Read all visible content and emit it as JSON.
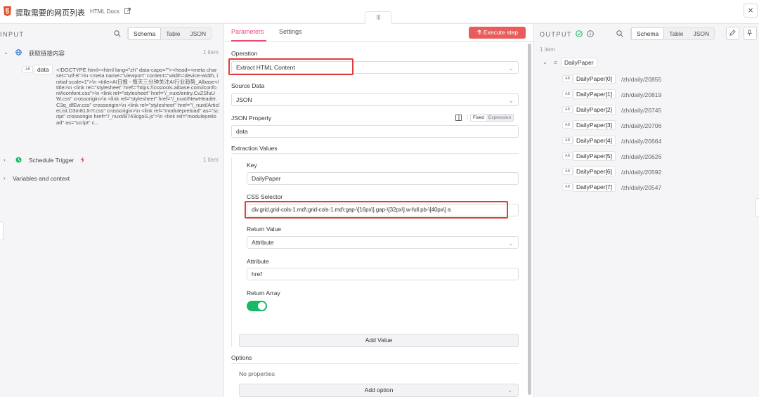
{
  "header": {
    "title": "提取需要的网页列表",
    "subtitle": "HTML Docs",
    "close": "×"
  },
  "input_panel": {
    "label": "INPUT",
    "tabs": [
      "Schema",
      "Table",
      "JSON"
    ],
    "node1": {
      "name": "获取链接内容",
      "count": "1 item"
    },
    "field": {
      "type": "AB",
      "key": "data",
      "value": "<!DOCTYPE html><html lang=\"zh\" data-capo=\"\"><head><meta charset=\"utf-8\">\\n <meta name=\"viewport\" content=\"width=device-width, initial-scale=1\">\\n <title>AI日报 - 每天三分钟关注AI行业趋势_Albase</title>\\n <link rel=\"stylesheet\" href=\"https://csstools.aibase.com/iconfont/iconfont.css\">\\n <link rel=\"stylesheet\" href=\"/_nuxt/entry.CvZSfuUW.css\" crossorigin>\\n <link rel=\"stylesheet\" href=\"/_nuxt/NewHeader.C3q_dfEw.css\" crossorigin>\\n <link rel=\"stylesheet\" href=\"/_nuxt/ArticleList.D3m81JnY.css\" crossorigin>\\n <link rel=\"modulepreload\" as=\"script\" crossorigin href=\"/_nuxt/B743cgoS.js\">\\n <link rel=\"modulepreload\" as=\"script\" c..."
    },
    "node2": {
      "name": "Schedule Trigger",
      "count": "1 item"
    },
    "node3": {
      "name": "Variables and context"
    }
  },
  "params_panel": {
    "tabs": [
      "Parameters",
      "Settings"
    ],
    "execute_label": "Execute step",
    "operation": {
      "label": "Operation",
      "value": "Extract HTML Content"
    },
    "source_data": {
      "label": "Source Data",
      "value": "JSON"
    },
    "json_property": {
      "label": "JSON Property",
      "value": "data",
      "modes": [
        "Fixed",
        "Expression"
      ]
    },
    "extraction_values_label": "Extraction Values",
    "key": {
      "label": "Key",
      "value": "DailyPaper"
    },
    "css_selector": {
      "label": "CSS Selector",
      "value": "div.grid.grid-cols-1.md\\:grid-cols-1.md\\:gap-\\[16px\\].gap-\\[32px\\].w-full.pb-\\[40px\\] a"
    },
    "return_value": {
      "label": "Return Value",
      "value": "Attribute"
    },
    "attribute": {
      "label": "Attribute",
      "value": "href"
    },
    "return_array": {
      "label": "Return Array",
      "value": true
    },
    "add_value_label": "Add Value",
    "options_label": "Options",
    "no_properties": "No properties",
    "add_option_label": "Add option"
  },
  "output_panel": {
    "label": "OUTPUT",
    "tabs": [
      "Schema",
      "Table",
      "JSON"
    ],
    "count": "1 item",
    "root_key": "DailyPaper",
    "items": [
      {
        "key": "DailyPaper[0]",
        "value": "/zh/daily/20855"
      },
      {
        "key": "DailyPaper[1]",
        "value": "/zh/daily/20819"
      },
      {
        "key": "DailyPaper[2]",
        "value": "/zh/daily/20745"
      },
      {
        "key": "DailyPaper[3]",
        "value": "/zh/daily/20706"
      },
      {
        "key": "DailyPaper[4]",
        "value": "/zh/daily/20664"
      },
      {
        "key": "DailyPaper[5]",
        "value": "/zh/daily/20626"
      },
      {
        "key": "DailyPaper[6]",
        "value": "/zh/daily/20592"
      },
      {
        "key": "DailyPaper[7]",
        "value": "/zh/daily/20547"
      }
    ]
  },
  "colors": {
    "accent": "#ea4b71",
    "execute": "#ea5b5b",
    "toggle_on": "#19b968",
    "highlight_box": "#e03c3c",
    "success": "#19b968"
  },
  "icons": {
    "logo": "html5-logo-icon",
    "external": "external-link-icon",
    "search": "search-icon",
    "globe": "globe-icon",
    "clock": "clock-icon",
    "lightning": "lightning-icon",
    "pencil": "pencil-icon",
    "pin": "pin-icon"
  }
}
